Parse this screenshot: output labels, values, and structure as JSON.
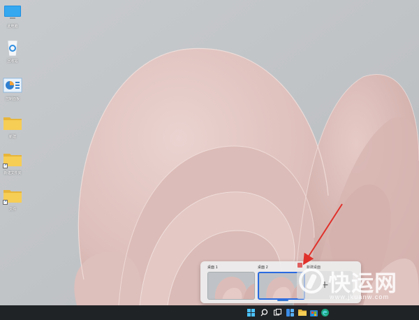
{
  "desktop": {
    "icons": [
      {
        "name": "此电脑",
        "type": "monitor"
      },
      {
        "name": "回收站",
        "type": "recycle-bin"
      },
      {
        "name": "控制面板",
        "type": "control-panel"
      },
      {
        "name": "新建",
        "type": "folder"
      },
      {
        "name": "新建文件夹",
        "type": "folder-shortcut"
      },
      {
        "name": "文件",
        "type": "folder-shortcut"
      }
    ]
  },
  "virtual_desktops": {
    "desktops": [
      {
        "label": "桌面 1",
        "active": false
      },
      {
        "label": "桌面 2",
        "active": true
      }
    ],
    "new_desktop_label": "新建桌面",
    "new_desktop_icon": "plus-icon"
  },
  "watermark": {
    "brand_text": "快运网",
    "url_text": "www.jkuanw.com"
  },
  "taskbar": {
    "buttons": [
      {
        "name": "start-button",
        "icon": "windows-logo-icon"
      },
      {
        "name": "search-button",
        "icon": "search-icon"
      },
      {
        "name": "task-view-button",
        "icon": "task-view-icon"
      },
      {
        "name": "widgets-button",
        "icon": "widgets-icon"
      },
      {
        "name": "file-explorer-button",
        "icon": "folder-icon"
      },
      {
        "name": "store-button",
        "icon": "store-icon"
      },
      {
        "name": "edge-button",
        "icon": "edge-icon"
      }
    ]
  },
  "colors": {
    "accent": "#2a6ae0",
    "taskbar": "#202326",
    "annotation_arrow": "#e0302a",
    "folder": "#f3c94b"
  }
}
